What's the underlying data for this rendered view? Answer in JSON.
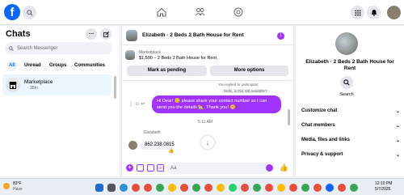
{
  "topbar": {
    "logo": "f",
    "nav": [
      "home-icon",
      "friends-icon",
      "groups-icon"
    ],
    "right_icons": [
      "menu-grid-icon",
      "bell-icon",
      "messenger-icon"
    ]
  },
  "left": {
    "title": "Chats",
    "search_placeholder": "Search Messenger",
    "filters": [
      "All",
      "Unread",
      "Groups",
      "Communities"
    ],
    "active_filter": "All",
    "item": {
      "name": "Marketplace",
      "time": "· 38m"
    }
  },
  "chat": {
    "title": "Elizabeth · 2 Beds 2 Bath House for Rent",
    "listing_label": "Marketplace",
    "listing_text": "$1,500 – 2 Beds 2 Bath House for Rent",
    "btn_pending": "Mark as pending",
    "btn_more": "More options",
    "replied": "You replied to participant",
    "quoted": "Hello, is this still available?",
    "my_message": "Hi Dear! 😊 please share your contact number    so I can send you the details 🏡. Thank you! 😊",
    "time_divider": "5:11 AM",
    "sender": "Elizabeth",
    "their_message": "862 238 0815",
    "their_reaction": "👍",
    "input_placeholder": "Aa",
    "scroll_down": "↓"
  },
  "right": {
    "title": "Elizabeth · 2 Beds 2 Bath House for Rent",
    "search_label": "Search",
    "rows": [
      "Customize chat",
      "Chat members",
      "Media, files and links",
      "Privacy & support"
    ]
  },
  "taskbar": {
    "temp": "83°F",
    "condition": "Haze",
    "time": "12:10 PM",
    "date": "5/7/2025",
    "colors": {
      "accent": "#a033ff",
      "brand": "#0866ff"
    }
  }
}
